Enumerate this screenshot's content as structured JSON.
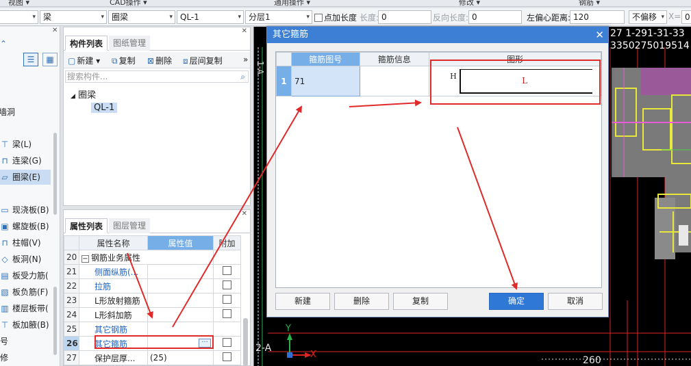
{
  "ribbon": {
    "items": [
      "视图 ▾",
      "CAD操作 ▾",
      "通用操作 ▾",
      "修改 ▾",
      "钢筋 ▾"
    ]
  },
  "toolbar": {
    "combo1": "",
    "combo2": "梁",
    "combo3": "圈梁",
    "combo4": "QL-1",
    "combo5": "分层1",
    "add_length_label": "点加长度",
    "length_label": "长度:",
    "length_value": "0",
    "reverse_length_label": "反向长度:",
    "reverse_length_value": "0",
    "left_offset_label": "左偏心距离:",
    "left_offset_value": "120",
    "offset_mode": "不偏移",
    "x_label": "X=",
    "x_value": "0"
  },
  "left_nav": {
    "partial_label": "墙洞",
    "items": [
      {
        "label": "梁(L)",
        "icon": "beam-icon"
      },
      {
        "label": "连梁(G)",
        "icon": "coupling-beam-icon"
      },
      {
        "label": "圈梁(E)",
        "icon": "ring-beam-icon",
        "selected": true
      },
      {
        "label": "现浇板(B)",
        "icon": "slab-icon"
      },
      {
        "label": "螺旋板(B)",
        "icon": "spiral-slab-icon"
      },
      {
        "label": "柱帽(V)",
        "icon": "column-cap-icon"
      },
      {
        "label": "板洞(N)",
        "icon": "slab-hole-icon"
      },
      {
        "label": "板受力筋(",
        "icon": "slab-rebar-icon"
      },
      {
        "label": "板负筋(F)",
        "icon": "negative-rebar-icon"
      },
      {
        "label": "楼层板带(",
        "icon": "floor-strip-icon"
      },
      {
        "label": "板加腋(B)",
        "icon": "haunch-icon"
      }
    ],
    "trailing": [
      "号",
      "修"
    ]
  },
  "component_panel": {
    "tabs": [
      "构件列表",
      "图纸管理"
    ],
    "toolbar": {
      "new": "新建",
      "copy": "复制",
      "delete": "删除",
      "floor_copy": "层间复制",
      "more": "»"
    },
    "search_placeholder": "搜索构件...",
    "tree_root": "圈梁",
    "tree_child": "QL-1"
  },
  "property_panel": {
    "tabs": [
      "属性列表",
      "图层管理"
    ],
    "columns": [
      "",
      "属性名称",
      "属性值",
      "附加"
    ],
    "rows": [
      {
        "no": "20",
        "name": "钢筋业务属性",
        "value": "",
        "group": true
      },
      {
        "no": "21",
        "name": "侧面纵筋(...",
        "value": "",
        "blue": true
      },
      {
        "no": "22",
        "name": "拉筋",
        "value": "",
        "blue": true
      },
      {
        "no": "23",
        "name": "L形放射箍筋",
        "value": ""
      },
      {
        "no": "24",
        "name": "L形斜加筋",
        "value": ""
      },
      {
        "no": "25",
        "name": "其它钢筋",
        "value": "",
        "blue": true
      },
      {
        "no": "26",
        "name": "其它箍筋",
        "value": "",
        "blue": true,
        "current": true
      },
      {
        "no": "27",
        "name": "保护层厚...",
        "value": "(25)"
      }
    ]
  },
  "canvas": {
    "top_text": "27 1-291-31-33",
    "top_text2": "3350275019514",
    "axis_left_text": "1-A",
    "bottom_label": "2-A",
    "dim_260": "260",
    "axis_x": "X",
    "axis_y": "Y"
  },
  "dialog": {
    "title": "其它箍筋",
    "columns": [
      "",
      "箍筋图号",
      "箍筋信息",
      "图形"
    ],
    "row": {
      "no": "1",
      "shape_no": "71",
      "info": "",
      "shape_h": "H",
      "shape_l": "L"
    },
    "buttons": {
      "new": "新建",
      "delete": "删除",
      "copy": "复制",
      "ok": "确定",
      "cancel": "取消"
    }
  },
  "colors": {
    "accent": "#3c7fd4",
    "header_blue": "#76aee8",
    "highlight_red": "#e02a2a",
    "canvas_bg": "#000000"
  }
}
